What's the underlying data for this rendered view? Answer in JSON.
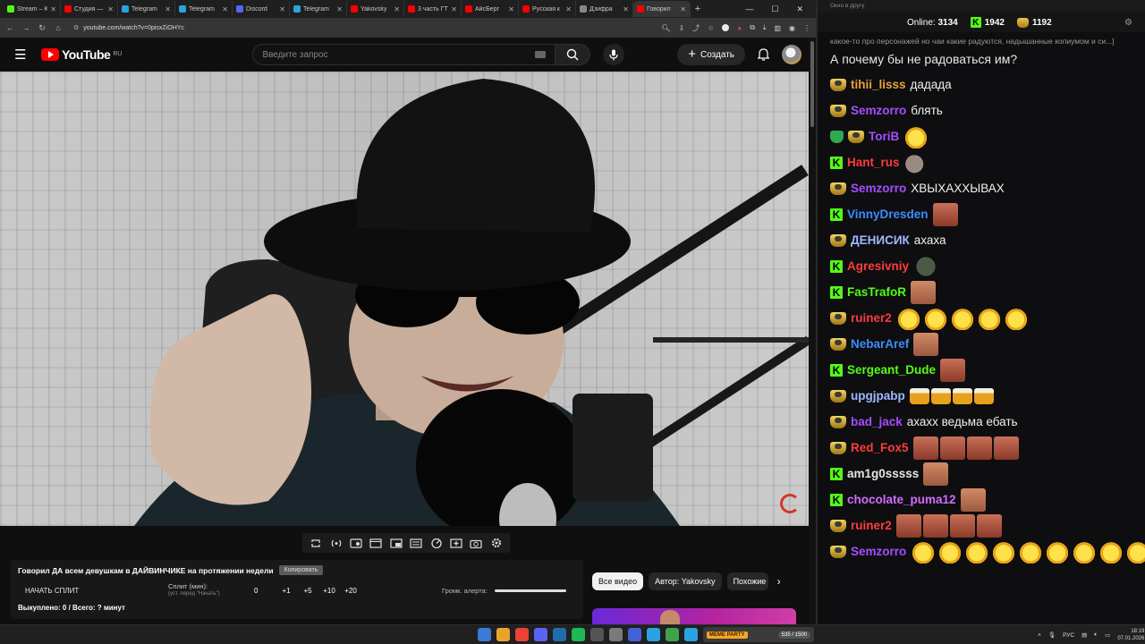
{
  "browser": {
    "tabs": [
      {
        "label": "Stream – K",
        "color": "#53fc18"
      },
      {
        "label": "Студия —",
        "color": "#ff0000"
      },
      {
        "label": "Telegram",
        "color": "#2aa3e0"
      },
      {
        "label": "Telegram",
        "color": "#2aa3e0"
      },
      {
        "label": "Discord",
        "color": "#5865f2"
      },
      {
        "label": "Telegram",
        "color": "#2aa3e0"
      },
      {
        "label": "Yakovsky",
        "color": "#ff0000"
      },
      {
        "label": "3 часть ГТ",
        "color": "#ff0000"
      },
      {
        "label": "АйсБерг",
        "color": "#ff0000"
      },
      {
        "label": "Русская к",
        "color": "#ff0000"
      },
      {
        "label": "Дзифра",
        "color": "#888888"
      },
      {
        "label": "Говорил",
        "color": "#ff0000",
        "active": true
      }
    ],
    "url": "youtube.com/watch?v=0pisxZiOHYc"
  },
  "youtube": {
    "logo_text": "YouTube",
    "region": "RU",
    "search_placeholder": "Введите запрос",
    "create_label": "Создать"
  },
  "split": {
    "video_title": "Говорил ДА всем девушкам в ДАЙВИНЧИКЕ на протяжении недели",
    "copy_label": "Копировать",
    "start_label": "НАЧАТЬ СПЛИТ",
    "split_min_label": "Сплит (мин):",
    "split_hint": "(уст. перед \"Начать\")",
    "split_value": "0",
    "increments": [
      "+1",
      "+5",
      "+10",
      "+20"
    ],
    "alert_volume_label": "Громк. алерта:",
    "alert_volume_level": 1.0,
    "stats": "Выкуплено: 0 / Всего: ? минут"
  },
  "chips": {
    "all": "Все видео",
    "author": "Автор: Yakovsky",
    "similar": "Похожие"
  },
  "chat": {
    "window_title": "Окно в другу",
    "online_label": "Online:",
    "online_value": "3134",
    "kick_count": "1942",
    "gold_count": "1192",
    "prev_line": "какое-то про персонажей но чаи какие радуются, надышанные копиумом и си...]",
    "prev_line2": "А почему бы не радоваться им?",
    "messages": [
      {
        "user": "tihii_lisss",
        "color": "#e8a23a",
        "badge": "gold",
        "text": "дадада",
        "emotes": []
      },
      {
        "user": "Semzorro",
        "color": "#a64dff",
        "badge": "gold",
        "text": "блять",
        "emotes": []
      },
      {
        "user": "ToriB",
        "color": "#a64dff",
        "badge": "shield+gold",
        "text": "",
        "emotes": [
          "laugh"
        ]
      },
      {
        "user": "Hant_rus",
        "color": "#ff3b3b",
        "badge": "kick",
        "text": "",
        "emotes": [
          "bunny"
        ]
      },
      {
        "user": "Semzorro",
        "color": "#a64dff",
        "badge": "gold",
        "text": "ХВЫХАХХЫВАХ",
        "emotes": []
      },
      {
        "user": "VinnyDresden",
        "color": "#3d8bff",
        "badge": "kick",
        "text": "",
        "emotes": [
          "face"
        ]
      },
      {
        "user": "ДЕНИСИК",
        "color": "#9fb8ff",
        "badge": "gold",
        "text": "ахаха",
        "emotes": []
      },
      {
        "user": "Agresivniy",
        "color": "#ff3b3b",
        "badge": "kick",
        "text": "",
        "emotes": [
          "stone"
        ]
      },
      {
        "user": "FasTrafoR",
        "color": "#53fc18",
        "badge": "kick",
        "text": "",
        "emotes": [
          "face2"
        ]
      },
      {
        "user": "ruiner2",
        "color": "#ff3b3b",
        "badge": "gold",
        "text": "",
        "emotes": [
          "laugh",
          "laugh",
          "laugh",
          "laugh",
          "laugh"
        ]
      },
      {
        "user": "NebarAref",
        "color": "#3d8bff",
        "badge": "gold",
        "text": "",
        "emotes": [
          "face2"
        ]
      },
      {
        "user": "Sergeant_Dude",
        "color": "#53fc18",
        "badge": "kick",
        "text": "",
        "emotes": [
          "face"
        ]
      },
      {
        "user": "upgjpabp",
        "color": "#9fb8ff",
        "badge": "gold",
        "text": "",
        "emotes": [
          "beer",
          "beer",
          "beer",
          "beer"
        ]
      },
      {
        "user": "bad_jack",
        "color": "#a64dff",
        "badge": "gold",
        "text": "ахахх ведьма ебать",
        "emotes": []
      },
      {
        "user": "Red_Fox5",
        "color": "#ff3b3b",
        "badge": "gold",
        "text": "",
        "emotes": [
          "face",
          "face",
          "face",
          "face"
        ]
      },
      {
        "user": "am1g0sssss",
        "color": "#e6e6e6",
        "badge": "kick",
        "text": "",
        "emotes": [
          "face2"
        ]
      },
      {
        "user": "chocolate_puma12",
        "color": "#d26bff",
        "badge": "kick",
        "text": "",
        "emotes": [
          "face2"
        ]
      },
      {
        "user": "ruiner2",
        "color": "#ff3b3b",
        "badge": "gold",
        "text": "",
        "emotes": [
          "face",
          "face",
          "face",
          "face"
        ]
      },
      {
        "user": "Semzorro",
        "color": "#a64dff",
        "badge": "gold",
        "text": "",
        "emotes": [
          "laugh",
          "laugh",
          "laugh",
          "laugh",
          "laugh",
          "laugh",
          "laugh",
          "laugh",
          "laugh"
        ]
      }
    ]
  },
  "taskbar": {
    "widget_tag": "MEME PARTY",
    "widget_count": "535 / 1500",
    "lang": "РУС",
    "time": "18:19",
    "date": "07.01.2026",
    "icon_colors": [
      "#3a7bd5",
      "#e9a52b",
      "#ea4335",
      "#5865f2",
      "#1e6fa8",
      "#1db954",
      "#555",
      "#7a7a7a",
      "#4462d6",
      "#2aa3e0",
      "#3fa34d",
      "#2aa3e0"
    ]
  }
}
